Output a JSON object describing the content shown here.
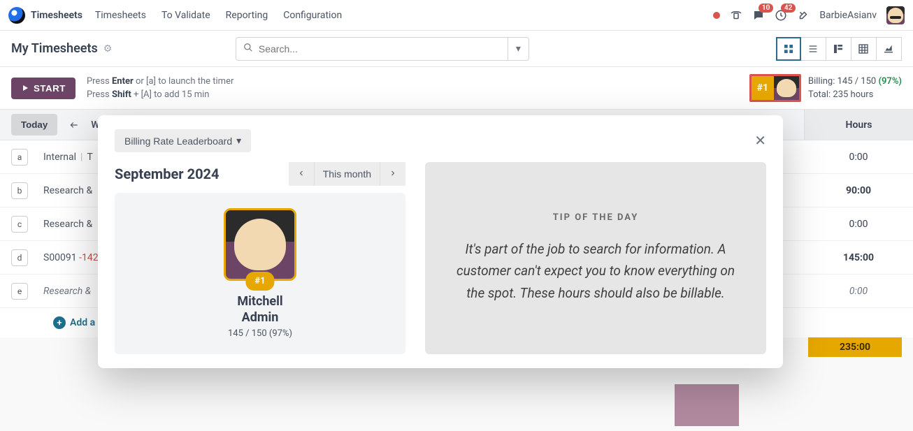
{
  "topnav": {
    "app": "Timesheets",
    "items": [
      "Timesheets",
      "To Validate",
      "Reporting",
      "Configuration"
    ],
    "chat_badge": "10",
    "clock_badge": "42",
    "user": "BarbieAsianv"
  },
  "subhead": {
    "title": "My Timesheets",
    "search_placeholder": "Search..."
  },
  "actionbar": {
    "start_label": "START",
    "hint1_pre": "Press ",
    "hint1_b": "Enter",
    "hint1_post": " or [a] to launch the timer",
    "hint2_pre": "Press ",
    "hint2_b": "Shift",
    "hint2_post": " + [A] to add 15 min",
    "rank": "#1",
    "billing_label": "Billing: 145 / 150 ",
    "billing_pct": "(97%)",
    "total_label": "Total: 235 hours"
  },
  "strip": {
    "today": "Today",
    "letter": "W",
    "hours_head": "Hours"
  },
  "rows": [
    {
      "key": "a",
      "label_a": "Internal",
      "sep": "|",
      "label_b": "T",
      "hours": "0:00",
      "bold": false,
      "italic": false
    },
    {
      "key": "b",
      "label_a": "Research &",
      "sep": "",
      "label_b": "",
      "hours": "90:00",
      "bold": true,
      "italic": false
    },
    {
      "key": "c",
      "label_a": "Research &",
      "sep": "",
      "label_b": "",
      "hours": "0:00",
      "bold": false,
      "italic": false
    },
    {
      "key": "d",
      "label_a": "S00091",
      "sep": "",
      "label_b": "-142",
      "hours": "145:00",
      "bold": true,
      "italic": false,
      "neg": true
    },
    {
      "key": "e",
      "label_a": "Research & ",
      "sep": "",
      "label_b": "",
      "hours": "0:00",
      "bold": false,
      "italic": true
    }
  ],
  "add_line": "Add a l",
  "totals": {
    "mid": "235:00",
    "end": "235:00"
  },
  "modal": {
    "dropdown": "Billing Rate Leaderboard",
    "month": "September 2024",
    "this_month": "This month",
    "leader_rank": "#1",
    "leader_name1": "Mitchell",
    "leader_name2": "Admin",
    "leader_stats": "145 / 150 (97%)",
    "tip_head": "TIP OF THE DAY",
    "tip_body": "It's part of the job to search for information. A customer can't expect you to know everything on the spot. These hours should also be billable."
  }
}
